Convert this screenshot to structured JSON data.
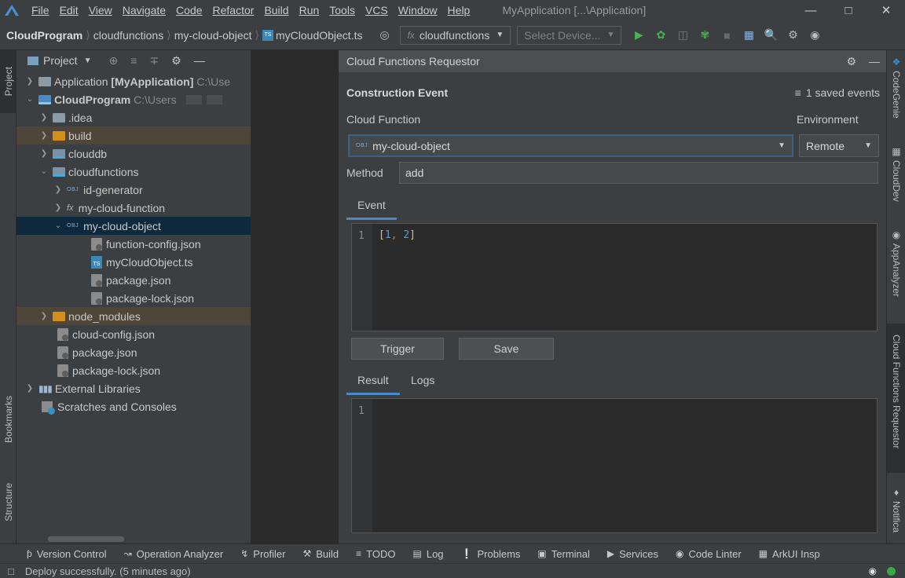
{
  "menu": [
    "File",
    "Edit",
    "View",
    "Navigate",
    "Code",
    "Refactor",
    "Build",
    "Run",
    "Tools",
    "VCS",
    "Window",
    "Help"
  ],
  "window_title": "MyApplication [...\\Application]",
  "breadcrumb": {
    "root": "CloudProgram",
    "c1": "cloudfunctions",
    "c2": "my-cloud-object",
    "file": "myCloudObject.ts"
  },
  "nav": {
    "config_combo": "cloudfunctions",
    "device_combo": "Select Device..."
  },
  "left_tabs": {
    "project": "Project",
    "bookmarks": "Bookmarks",
    "structure": "Structure"
  },
  "project_panel": {
    "title": "Project",
    "tree": [
      {
        "label": "Application",
        "bold": "[MyApplication]",
        "hint": "C:\\Use"
      },
      {
        "label": "CloudProgram",
        "hint": "C:\\Users"
      },
      {
        "label": ".idea"
      },
      {
        "label": "build"
      },
      {
        "label": "clouddb"
      },
      {
        "label": "cloudfunctions"
      },
      {
        "label": "id-generator"
      },
      {
        "label": "my-cloud-function"
      },
      {
        "label": "my-cloud-object"
      },
      {
        "label": "function-config.json"
      },
      {
        "label": "myCloudObject.ts"
      },
      {
        "label": "package.json"
      },
      {
        "label": "package-lock.json"
      },
      {
        "label": "node_modules"
      },
      {
        "label": "cloud-config.json"
      },
      {
        "label": "package.json"
      },
      {
        "label": "package-lock.json"
      },
      {
        "label": "External Libraries"
      },
      {
        "label": "Scratches and Consoles"
      }
    ]
  },
  "requestor": {
    "title": "Cloud Functions Requestor",
    "section_title": "Construction Event",
    "saved_events": "1 saved events",
    "cloud_function_label": "Cloud Function",
    "environment_label": "Environment",
    "function_value": "my-cloud-object",
    "environment_value": "Remote",
    "method_label": "Method",
    "method_value": "add",
    "event_tab": "Event",
    "event_line_no": "1",
    "event_code": {
      "open": "[",
      "a": "1",
      "comma": ", ",
      "b": "2",
      "close": "]"
    },
    "trigger_button": "Trigger",
    "save_button": "Save",
    "result_tab": "Result",
    "logs_tab": "Logs",
    "result_line_no": "1"
  },
  "right_tabs": [
    "CodeGenie",
    "CloudDev",
    "AppAnalyzer",
    "Cloud Functions Requestor",
    "Notifica"
  ],
  "bottom_tools": [
    "Version Control",
    "Operation Analyzer",
    "Profiler",
    "Build",
    "TODO",
    "Log",
    "Problems",
    "Terminal",
    "Services",
    "Code Linter",
    "ArkUI Insp"
  ],
  "status": "Deploy successfully. (5 minutes ago)"
}
